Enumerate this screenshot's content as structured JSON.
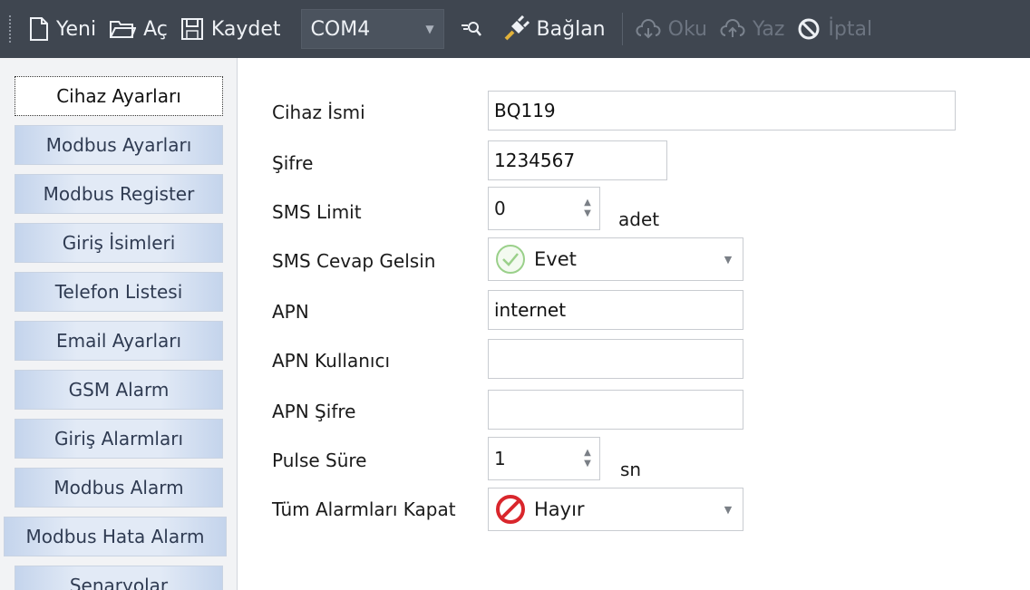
{
  "toolbar": {
    "new_label": "Yeni",
    "open_label": "Aç",
    "save_label": "Kaydet",
    "port_value": "COM4",
    "connect_label": "Bağlan",
    "read_label": "Oku",
    "write_label": "Yaz",
    "cancel_label": "İptal"
  },
  "sidebar": {
    "items": [
      {
        "label": "Cihaz Ayarları"
      },
      {
        "label": "Modbus Ayarları"
      },
      {
        "label": "Modbus Register"
      },
      {
        "label": "Giriş İsimleri"
      },
      {
        "label": "Telefon Listesi"
      },
      {
        "label": "Email Ayarları"
      },
      {
        "label": "GSM Alarm"
      },
      {
        "label": "Giriş Alarmları"
      },
      {
        "label": "Modbus Alarm"
      },
      {
        "label": "Modbus Hata Alarm"
      },
      {
        "label": "Senaryolar"
      }
    ]
  },
  "form": {
    "device_name": {
      "label": "Cihaz İsmi",
      "value": "BQ119"
    },
    "password": {
      "label": "Şifre",
      "value": "1234567"
    },
    "sms_limit": {
      "label": "SMS Limit",
      "value": "0",
      "unit": "adet"
    },
    "sms_reply": {
      "label": "SMS Cevap Gelsin",
      "value": "Evet"
    },
    "apn": {
      "label": "APN",
      "value": "internet"
    },
    "apn_user": {
      "label": "APN Kullanıcı",
      "value": ""
    },
    "apn_password": {
      "label": "APN Şifre",
      "value": ""
    },
    "pulse_time": {
      "label": "Pulse Süre",
      "value": "1",
      "unit": "sn"
    },
    "disable_alarms": {
      "label": "Tüm Alarmları Kapat",
      "value": "Hayır"
    }
  },
  "colors": {
    "toolbar_bg": "#3f4650",
    "sidebar_button": "#dde6f4",
    "yes_icon": "#9ad08a",
    "no_icon": "#d9262c"
  }
}
